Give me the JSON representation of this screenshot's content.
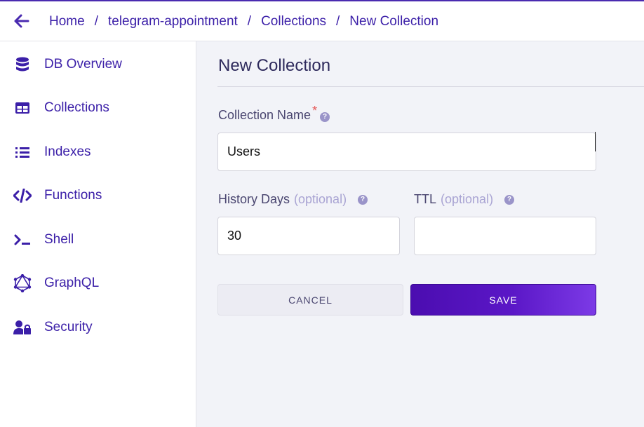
{
  "header": {
    "breadcrumb": [
      "Home",
      "telegram-appointment",
      "Collections",
      "New Collection"
    ],
    "separator": "/"
  },
  "sidebar": {
    "items": [
      {
        "label": "DB Overview",
        "icon": "database-icon"
      },
      {
        "label": "Collections",
        "icon": "table-icon"
      },
      {
        "label": "Indexes",
        "icon": "list-icon"
      },
      {
        "label": "Functions",
        "icon": "code-icon"
      },
      {
        "label": "Shell",
        "icon": "terminal-icon"
      },
      {
        "label": "GraphQL",
        "icon": "graphql-icon"
      },
      {
        "label": "Security",
        "icon": "user-lock-icon"
      }
    ]
  },
  "form": {
    "title": "New Collection",
    "collection_name": {
      "label": "Collection Name",
      "required_mark": "*",
      "value": "Users"
    },
    "history_days": {
      "label": "History Days",
      "optional": "(optional)",
      "value": "30"
    },
    "ttl": {
      "label": "TTL",
      "optional": "(optional)",
      "value": ""
    },
    "help_glyph": "?",
    "cancel_label": "CANCEL",
    "save_label": "SAVE"
  },
  "colors": {
    "accent": "#3b1fa8",
    "save_gradient_start": "#4b0db0",
    "save_gradient_end": "#7c3ae6",
    "required": "#e55a5a",
    "optional_text": "#a9a4d3"
  }
}
